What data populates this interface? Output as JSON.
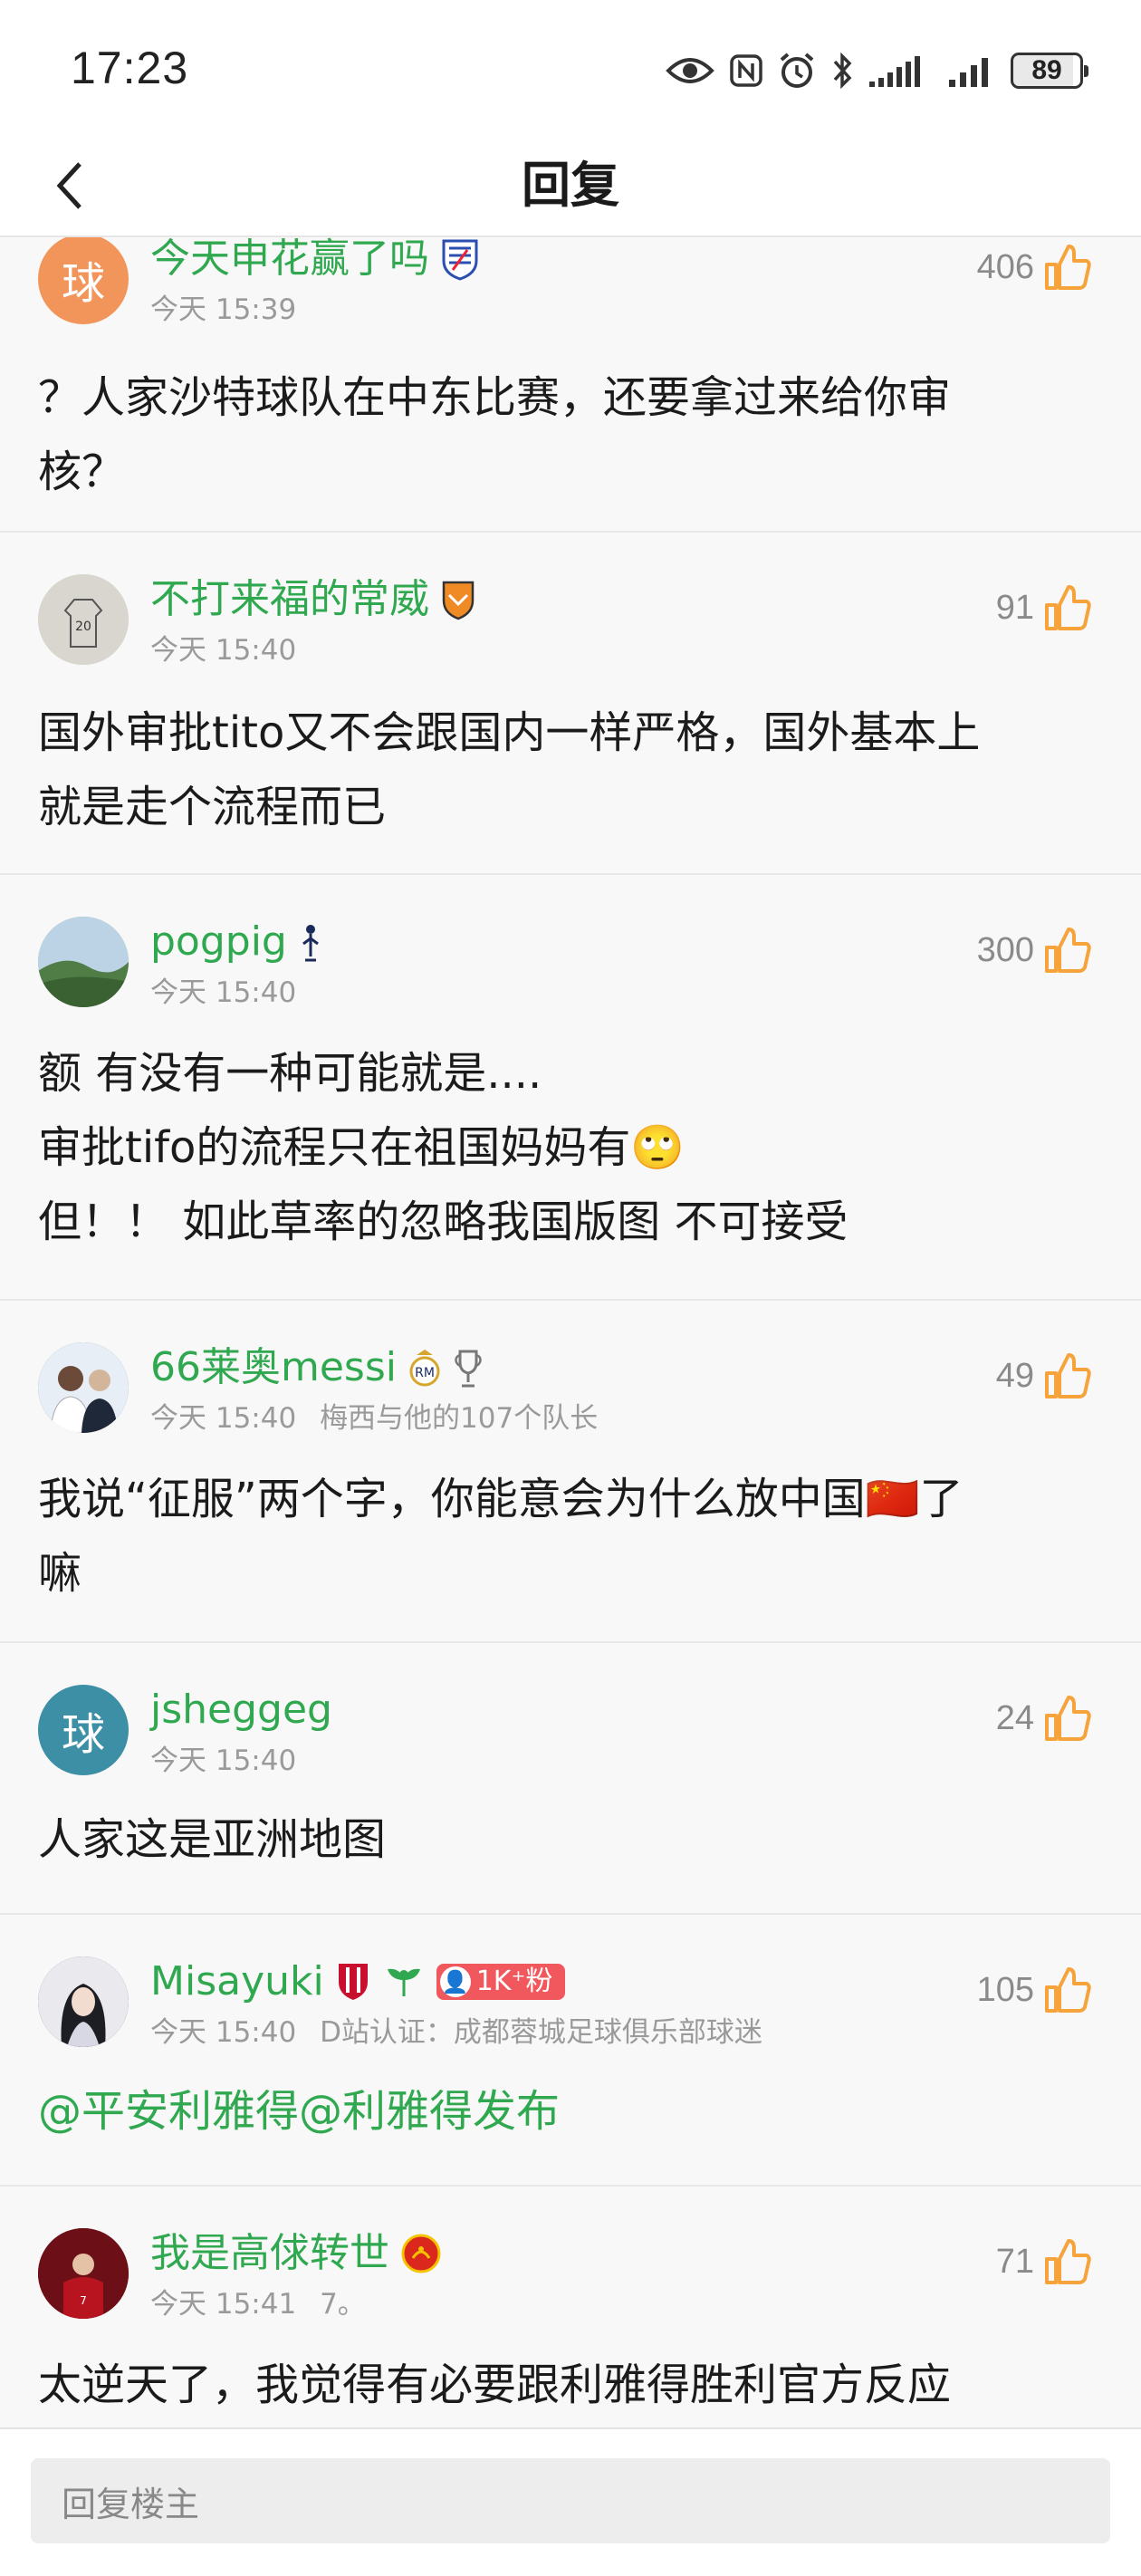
{
  "status_bar": {
    "time": "17:23",
    "battery": "89",
    "icons": [
      "eye-icon",
      "nfc-icon",
      "alarm-icon",
      "bluetooth-icon",
      "signal-icon",
      "signal-icon",
      "battery-icon"
    ]
  },
  "nav": {
    "title": "回复",
    "back_icon": "chevron-left-icon"
  },
  "comments": [
    {
      "username": "今天申花赢了吗",
      "avatar_text": "球",
      "avatar_color": "#f2955b",
      "time": "今天 15:39",
      "meta_extra": "",
      "likes": "406",
      "content": [
        "？人家沙特球队在中东比赛，还要拿过来给你审",
        "核？"
      ]
    },
    {
      "username": "不打来福的常威",
      "avatar_text": "",
      "avatar_color": "#d9d6cf",
      "time": "今天 15:40",
      "meta_extra": "",
      "likes": "91",
      "content": [
        "国外审批tito又不会跟国内一样严格，国外基本上",
        "就是走个流程而已"
      ]
    },
    {
      "username": "pogpig",
      "avatar_text": "",
      "avatar_color": "#7fa37a",
      "time": "今天 15:40",
      "meta_extra": "",
      "likes": "300",
      "content": [
        "额 有没有一种可能就是....",
        "审批tifo的流程只在祖国妈妈有🙄",
        "但！！ 如此草率的忽略我国版图 不可接受"
      ]
    },
    {
      "username": "66莱奥messi",
      "avatar_text": "",
      "avatar_color": "#5a6f8a",
      "time": "今天 15:40",
      "meta_extra": "梅西与他的107个队长",
      "likes": "49",
      "content": [
        "我说“征服”两个字，你能意会为什么放中国🇨🇳了",
        "嘛"
      ]
    },
    {
      "username": "jsheggeg",
      "avatar_text": "球",
      "avatar_color": "#3d8fa6",
      "time": "今天 15:40",
      "meta_extra": "",
      "likes": "24",
      "content": [
        "人家这是亚洲地图"
      ]
    },
    {
      "username": "Misayuki",
      "avatar_text": "",
      "avatar_color": "#2d3340",
      "time": "今天 15:40",
      "meta_extra": "D站认证：成都蓉城足球俱乐部球迷",
      "likes": "105",
      "fan_badge": "1K⁺粉",
      "content": [
        "@平安利雅得@利雅得发布"
      ]
    },
    {
      "username": "我是高俅转世",
      "avatar_text": "",
      "avatar_color": "#7a1118",
      "time": "今天 15:41",
      "meta_extra": "7。",
      "likes": "71",
      "content": [
        "太逆天了，我觉得有必要跟利雅得胜利官方反应"
      ]
    }
  ],
  "reply_bar": {
    "placeholder": "回复楼主"
  },
  "colors": {
    "username_green": "#2fa84f",
    "like_orange": "#f5a33a",
    "fan_badge_red": "#f0585d"
  }
}
